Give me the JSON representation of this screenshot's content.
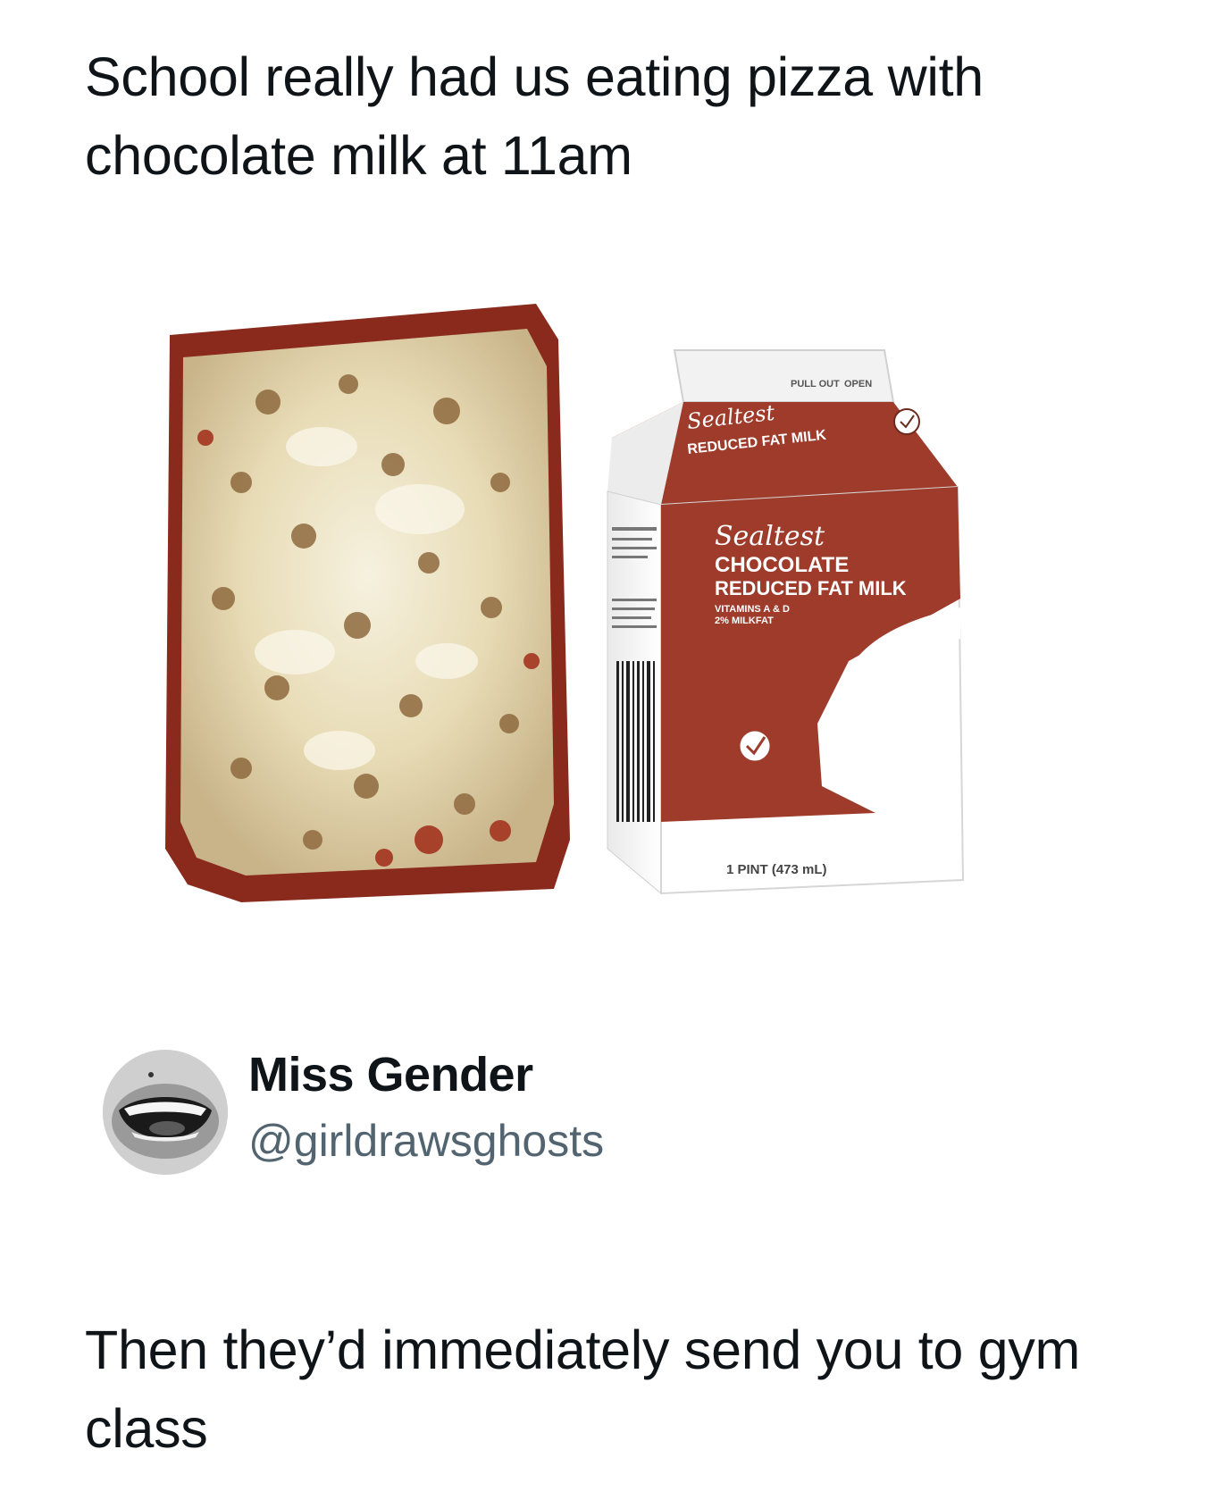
{
  "tweet": {
    "text": "School really had us eating pizza with chocolate milk at 11am",
    "media": {
      "pizza_image": "rectangular-school-pizza-slice",
      "milk_carton_image": "sealtest-chocolate-milk-carton",
      "carton_text": {
        "top_flap": "SEALTEST",
        "tab_left": "PULL OUT",
        "tab_right": "OPEN",
        "brand": "Sealtest",
        "product_line_1": "CHOCOLATE",
        "product_line_2": "REDUCED FAT MILK",
        "vitamins": "VITAMINS A & D",
        "fat": "2% MILKFAT",
        "size": "1 PINT (473 mL)"
      }
    }
  },
  "author": {
    "display_name": "Miss Gender",
    "handle": "@girldrawsghosts",
    "avatar": "avatar-mouth-icon"
  },
  "reply": {
    "text": "Then they’d immediately send you to gym class"
  },
  "colors": {
    "text_primary": "#0f1419",
    "text_secondary": "#536471",
    "carton_brown": "#9e3b2b",
    "background": "#ffffff"
  }
}
